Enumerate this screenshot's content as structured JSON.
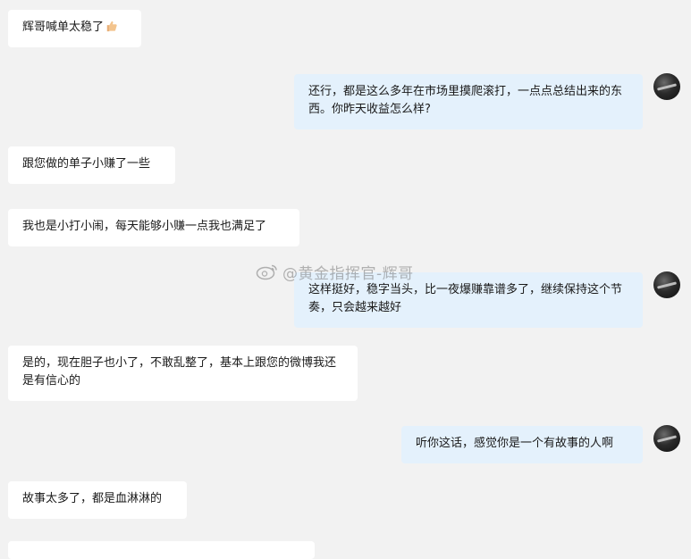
{
  "messages": [
    {
      "side": "left",
      "text": "辉哥喊单太稳了"
    },
    {
      "side": "right",
      "text": "还行，都是这么多年在市场里摸爬滚打，一点点总结出来的东西。你昨天收益怎么样?"
    },
    {
      "side": "left",
      "text": "跟您做的单子小赚了一些"
    },
    {
      "side": "left",
      "text": "我也是小打小闹，每天能够小赚一点我也满足了"
    },
    {
      "side": "right",
      "text": "这样挺好，稳字当头，比一夜爆赚靠谱多了，继续保持这个节奏，只会越来越好"
    },
    {
      "side": "left",
      "text": "是的，现在胆子也小了，不敢乱整了，基本上跟您的微博我还是有信心的"
    },
    {
      "side": "right",
      "text": "听你这话，感觉你是一个有故事的人啊"
    },
    {
      "side": "left",
      "text": "故事太多了，都是血淋淋的"
    }
  ],
  "watermark": {
    "text": "@黄金指挥官-辉哥",
    "icon": "weibo-icon"
  },
  "emoji": {
    "icon": "thumbs-up-icon"
  }
}
